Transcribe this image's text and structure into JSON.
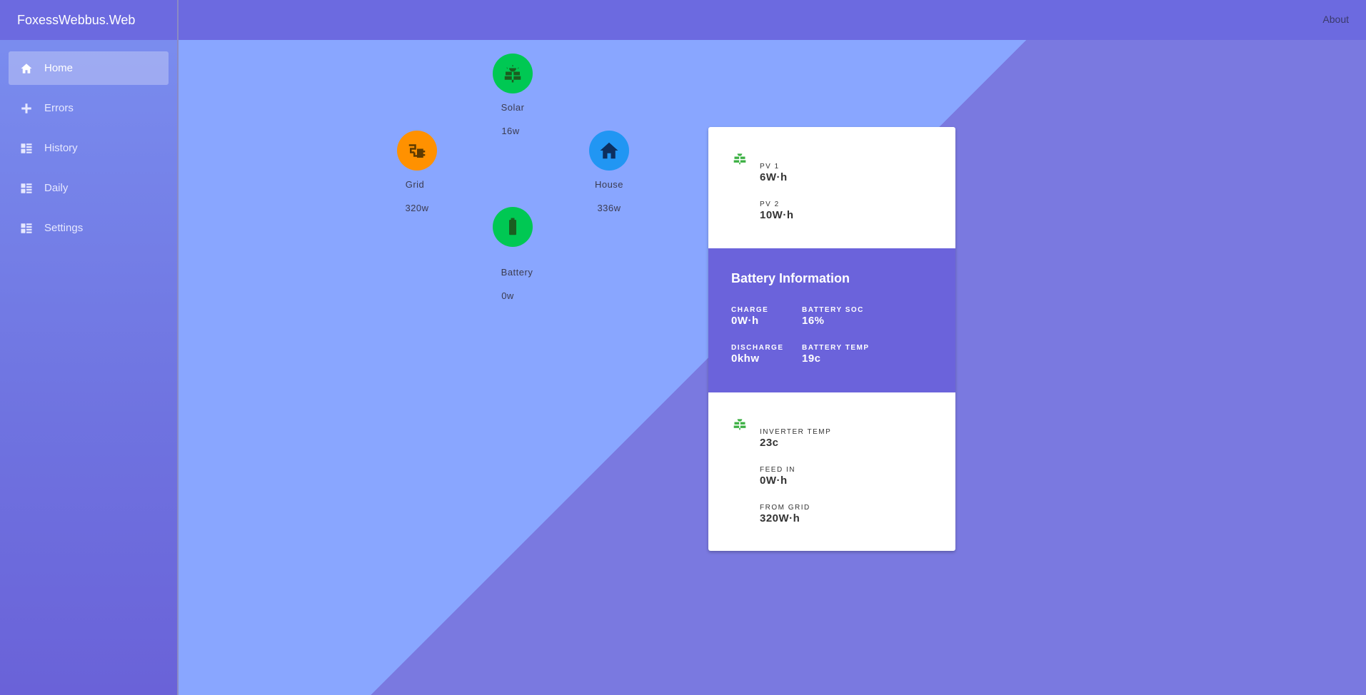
{
  "app": {
    "title": "FoxessWebbus.Web",
    "about_label": "About"
  },
  "sidebar": {
    "items": [
      {
        "label": "Home",
        "icon": "home-icon"
      },
      {
        "label": "Errors",
        "icon": "plus-icon"
      },
      {
        "label": "History",
        "icon": "list-icon"
      },
      {
        "label": "Daily",
        "icon": "list-icon"
      },
      {
        "label": "Settings",
        "icon": "list-icon"
      }
    ]
  },
  "flow": {
    "solar": {
      "label": "Solar",
      "value": "16w",
      "color": "#00c853"
    },
    "grid": {
      "label": "Grid",
      "value": "320w",
      "color": "#ff9100"
    },
    "house": {
      "label": "House",
      "value": "336w",
      "color": "#2196f3"
    },
    "battery": {
      "label": "Battery",
      "value": "0w",
      "color": "#00c853"
    }
  },
  "card": {
    "pv": [
      {
        "label": "PV 1",
        "value": "6W·h"
      },
      {
        "label": "PV 2",
        "value": "10W·h"
      }
    ],
    "battery": {
      "title": "Battery Information",
      "charge_label": "CHARGE",
      "charge_value": "0W·h",
      "soc_label": "BATTERY SOC",
      "soc_value": "16%",
      "discharge_label": "DISCHARGE",
      "discharge_value": "0khw",
      "temp_label": "BATTERY TEMP",
      "temp_value": "19c"
    },
    "inverter": [
      {
        "label": "INVERTER TEMP",
        "value": "23c"
      },
      {
        "label": "FEED IN",
        "value": "0W·h"
      },
      {
        "label": "FROM GRID",
        "value": "320W·h"
      }
    ]
  },
  "colors": {
    "accent": "#6b63db",
    "solar_icon": "#3cb043"
  }
}
